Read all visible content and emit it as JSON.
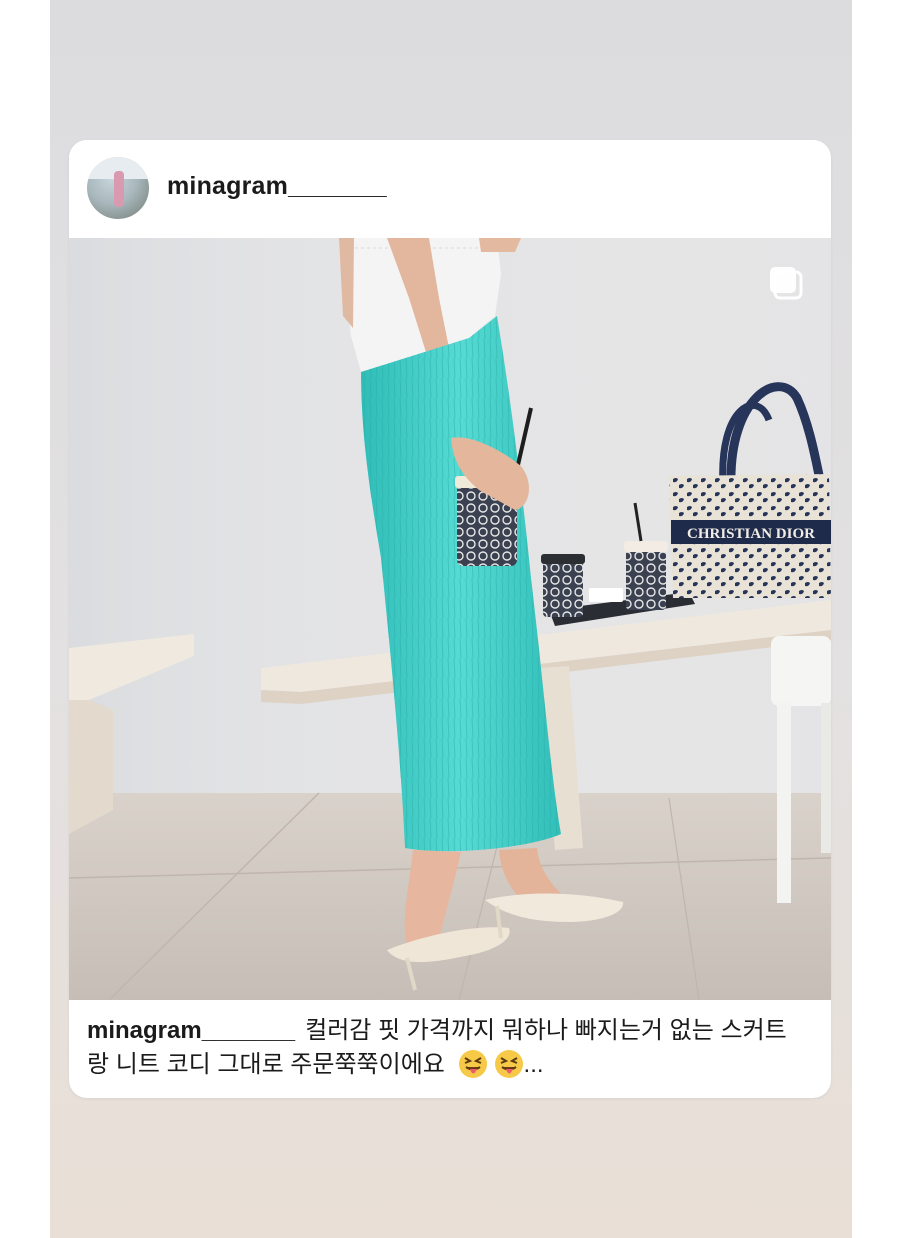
{
  "post": {
    "username": "minagram_______",
    "caption_text": "컬러감 핏 가격까지 뭐하나 빠지는거 없는 스커트랑 니트 코디 그대로 주문쭉쭉이에요",
    "caption_more": "...",
    "emoji_names": [
      "squinting-face-with-tongue",
      "squinting-face-with-tongue"
    ],
    "media_indicator": "multiple-photos-icon"
  },
  "photo": {
    "bag_text": "CHRISTIAN DIOR",
    "colors": {
      "skirt": "#3fcfc8",
      "wall": "#e4e4e6",
      "floor": "#cfc8c1",
      "bench": "#eee6dc"
    }
  },
  "colors": {
    "text": "#1b1b1b",
    "card": "#ffffff"
  }
}
